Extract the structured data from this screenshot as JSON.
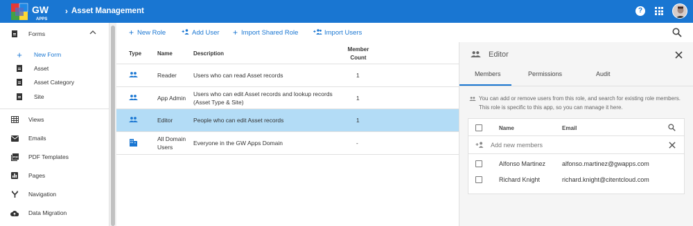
{
  "header": {
    "logo_text": "GW",
    "logo_sub": "APPS",
    "breadcrumb": "Asset Management",
    "icons": [
      "help-icon",
      "apps-grid-icon",
      "avatar"
    ]
  },
  "sidebar": {
    "forms_label": "Forms",
    "sub_items": [
      {
        "label": "New Form",
        "icon": "plus-icon",
        "active": true
      },
      {
        "label": "Asset",
        "icon": "document-icon"
      },
      {
        "label": "Asset Category",
        "icon": "document-icon"
      },
      {
        "label": "Site",
        "icon": "document-icon"
      }
    ],
    "items": [
      {
        "label": "Views",
        "icon": "table-icon"
      },
      {
        "label": "Emails",
        "icon": "mail-icon"
      },
      {
        "label": "PDF Templates",
        "icon": "pdf-icon"
      },
      {
        "label": "Pages",
        "icon": "chart-icon"
      },
      {
        "label": "Navigation",
        "icon": "navigation-icon"
      },
      {
        "label": "Data Migration",
        "icon": "cloud-upload-icon"
      }
    ]
  },
  "toolbar": {
    "new_role": "New Role",
    "add_user": "Add User",
    "import_shared_role": "Import Shared Role",
    "import_users": "Import Users"
  },
  "table": {
    "headers": {
      "type": "Type",
      "name": "Name",
      "description": "Description",
      "member_count_1": "Member",
      "member_count_2": "Count"
    },
    "rows": [
      {
        "icon": "group-icon",
        "name": "Reader",
        "description": "Users who can read Asset records",
        "count": "1"
      },
      {
        "icon": "group-icon",
        "name": "App Admin",
        "description_1": "Users who can edit Asset records and lookup records",
        "description_2": "(Asset Type & Site)",
        "count": "1"
      },
      {
        "icon": "group-icon",
        "name": "Editor",
        "description": "People who can edit Asset records",
        "count": "1",
        "selected": true
      },
      {
        "icon": "domain-icon",
        "name_1": "All Domain",
        "name_2": "Users",
        "description": "Everyone in the GW Apps Domain",
        "count": "-"
      }
    ]
  },
  "panel": {
    "title": "Editor",
    "tabs": [
      "Members",
      "Permissions",
      "Audit"
    ],
    "active_tab": "Members",
    "info_1": "You can add or remove users from this role, and search for existing role members.",
    "info_2": "This role is specific to this app, so you can manage it here.",
    "members_header": {
      "name": "Name",
      "email": "Email"
    },
    "add_placeholder": "Add new members",
    "members": [
      {
        "name": "Alfonso Martinez",
        "email": "alfonso.martinez@gwapps.com"
      },
      {
        "name": "Richard Knight",
        "email": "richard.knight@citentcloud.com"
      }
    ]
  },
  "colors": {
    "primary": "#1976d2",
    "selected_row": "#b3dcf6"
  }
}
